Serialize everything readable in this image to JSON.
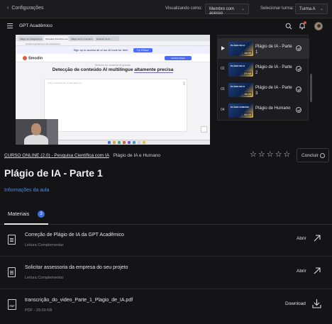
{
  "topbar": {
    "back_label": "Configurações",
    "viewing_label": "Visualizando como:",
    "viewing_value": "Membro com acesso",
    "turma_label": "Selecionar turma:",
    "turma_value": "Turma A"
  },
  "appbar": {
    "brand": "GPT Acadêmico"
  },
  "video": {
    "tabs": [
      "Plágio de Inteligência A...",
      "Pesquisa Científica com IA",
      "Plágio de IA e Humano",
      "Detector de IA..."
    ],
    "url": "smodin.io/pt/detector-de-conteudo-ia",
    "banner_text": "Sign up to access all of our AI tools for free!",
    "banner_button": "Try It Now!",
    "site_logo": "Smodin",
    "nav_button": "Verificar Plágio",
    "page_sub": "Detector de conteúdo IA gratuito",
    "heading_pre": "Detecção de conteúdo AI multilíngue",
    "heading_mark": "altamente precisa",
    "textarea_placeholder": "Cole o conteúdo de IA aqui para ver..."
  },
  "playlist": {
    "items": [
      {
        "num": "",
        "title": "Plágio de IA - Parte 1",
        "time": "18:00",
        "thumb": "PLÁGIO DE IA"
      },
      {
        "num": "02",
        "title": "Plágio de IA - Parte 2",
        "time": "23:48",
        "thumb": "PLÁGIO DE IA"
      },
      {
        "num": "03",
        "title": "Plágio de IA - Parte 3",
        "time": "16:25",
        "thumb": "PLÁGIO DE IA"
      },
      {
        "num": "04",
        "title": "Plágio de Humano",
        "time": "06:20",
        "thumb": "PLÁGIO HUMANO"
      }
    ]
  },
  "course": {
    "link": "CURSO ONLINE (2.0) - Pesquisa Científica com IA",
    "module": "Plágio de IA e Humano",
    "rating_stars": 5,
    "rating_value": 0,
    "concluir_label": "Concluir"
  },
  "lesson": {
    "title": "Plágio de IA - Parte 1",
    "info_link": "Informações da aula"
  },
  "tabs": {
    "materiais_label": "Materiais",
    "materiais_count": "3"
  },
  "materials": [
    {
      "title": "Correção de Plágio de IA da GPT Acadêmico",
      "sub": "Leitura Complementar",
      "action": "Abrir",
      "type": "doc"
    },
    {
      "title": "Solicitar assessoria da empresa do seu projeto",
      "sub": "Leitura Complementar",
      "action": "Abrir",
      "type": "doc"
    },
    {
      "title": "transcrição_do_video_Parte_1_Plagio_de_IA.pdf",
      "sub": "PDF - 29.09 KB",
      "action": "Download",
      "type": "pdf",
      "badge": "PDF"
    }
  ],
  "colors": {
    "accent": "#3b6fe0",
    "link": "#4d8fe8",
    "background": "#141417"
  },
  "icons": [
    "chevron-left-icon",
    "hamburger-menu-icon",
    "search-icon",
    "bell-icon",
    "play-icon",
    "check-circle-icon",
    "star-icon",
    "arrow-up-right-icon",
    "download-icon",
    "document-icon",
    "pdf-icon"
  ]
}
